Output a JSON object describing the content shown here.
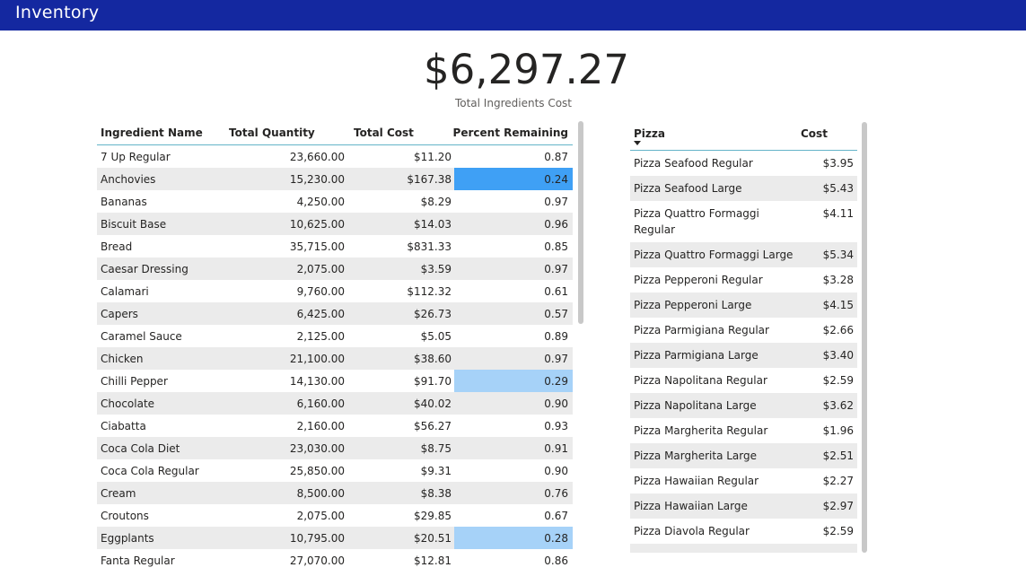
{
  "header": {
    "title": "Inventory",
    "bar_color": "#1428a0"
  },
  "kpi": {
    "value": "$6,297.27",
    "label": "Total Ingredients Cost"
  },
  "ingredients": {
    "columns": [
      "Ingredient Name",
      "Total Quantity",
      "Total Cost",
      "Percent Remaining"
    ],
    "rows": [
      [
        "7 Up Regular",
        "23,660.00",
        "$11.20",
        "0.87"
      ],
      [
        "Anchovies",
        "15,230.00",
        "$167.38",
        "0.24"
      ],
      [
        "Bananas",
        "4,250.00",
        "$8.29",
        "0.97"
      ],
      [
        "Biscuit Base",
        "10,625.00",
        "$14.03",
        "0.96"
      ],
      [
        "Bread",
        "35,715.00",
        "$831.33",
        "0.85"
      ],
      [
        "Caesar Dressing",
        "2,075.00",
        "$3.59",
        "0.97"
      ],
      [
        "Calamari",
        "9,760.00",
        "$112.32",
        "0.61"
      ],
      [
        "Capers",
        "6,425.00",
        "$26.73",
        "0.57"
      ],
      [
        "Caramel Sauce",
        "2,125.00",
        "$5.05",
        "0.89"
      ],
      [
        "Chicken",
        "21,100.00",
        "$38.60",
        "0.97"
      ],
      [
        "Chilli Pepper",
        "14,130.00",
        "$91.70",
        "0.29"
      ],
      [
        "Chocolate",
        "6,160.00",
        "$40.02",
        "0.90"
      ],
      [
        "Ciabatta",
        "2,160.00",
        "$56.27",
        "0.93"
      ],
      [
        "Coca Cola Diet",
        "23,030.00",
        "$8.75",
        "0.91"
      ],
      [
        "Coca Cola Regular",
        "25,850.00",
        "$9.31",
        "0.90"
      ],
      [
        "Cream",
        "8,500.00",
        "$8.38",
        "0.76"
      ],
      [
        "Croutons",
        "2,075.00",
        "$29.85",
        "0.67"
      ],
      [
        "Eggplants",
        "10,795.00",
        "$20.51",
        "0.28"
      ],
      [
        "Fanta Regular",
        "27,070.00",
        "$12.81",
        "0.86"
      ]
    ],
    "highlight_colors": {
      "0.24": "#3fa0f5",
      "0.29": "#a6d2f8",
      "0.28": "#a6d2f8"
    }
  },
  "pizzas": {
    "columns": [
      "Pizza",
      "Cost"
    ],
    "rows": [
      [
        "Pizza Seafood Regular",
        "$3.95"
      ],
      [
        "Pizza Seafood Large",
        "$5.43"
      ],
      [
        "Pizza Quattro Formaggi Regular",
        "$4.11"
      ],
      [
        "Pizza Quattro Formaggi Large",
        "$5.34"
      ],
      [
        "Pizza Pepperoni Regular",
        "$3.28"
      ],
      [
        "Pizza Pepperoni Large",
        "$4.15"
      ],
      [
        "Pizza Parmigiana Regular",
        "$2.66"
      ],
      [
        "Pizza Parmigiana Large",
        "$3.40"
      ],
      [
        "Pizza Napolitana Regular",
        "$2.59"
      ],
      [
        "Pizza Napolitana Large",
        "$3.62"
      ],
      [
        "Pizza Margherita Regular",
        "$1.96"
      ],
      [
        "Pizza Margherita Large",
        "$2.51"
      ],
      [
        "Pizza Hawaiian Regular",
        "$2.27"
      ],
      [
        "Pizza Hawaiian Large",
        "$2.97"
      ],
      [
        "Pizza Diavola Regular",
        "$2.59"
      ]
    ]
  }
}
